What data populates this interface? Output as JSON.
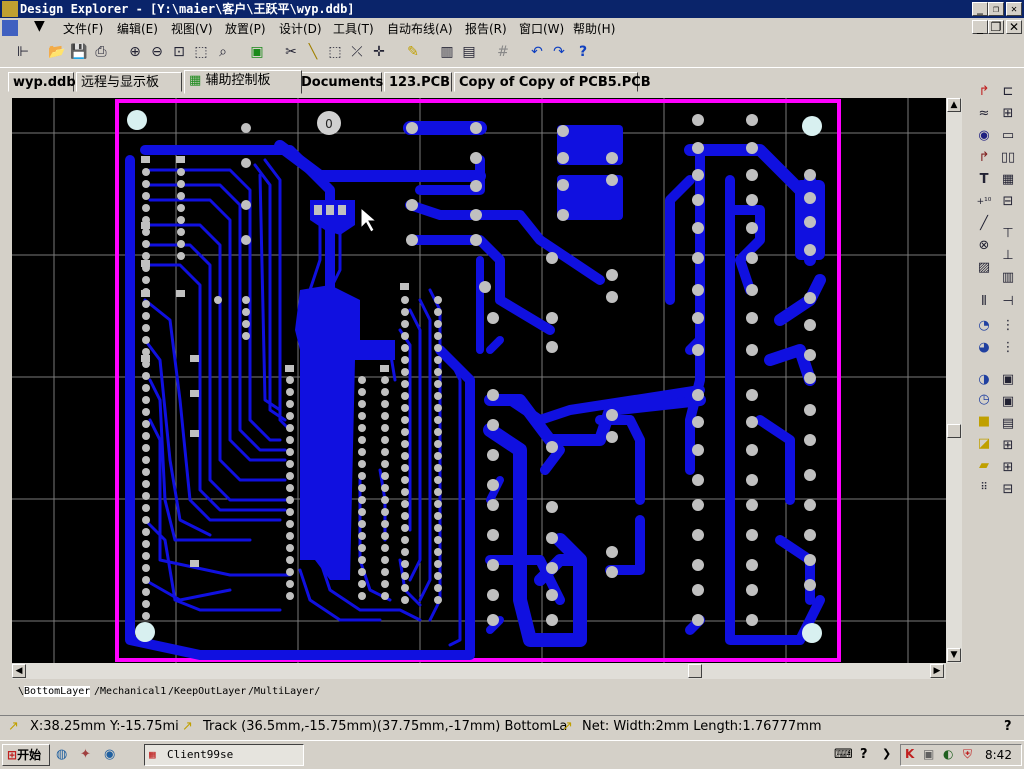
{
  "window": {
    "title": "Design Explorer - [Y:\\maier\\客户\\王跃平\\wyp.ddb]",
    "min_glyph": "_",
    "max_glyph": "❐",
    "close_glyph": "✕"
  },
  "menu": [
    "文件(F)",
    "编辑(E)",
    "视图(V)",
    "放置(P)",
    "设计(D)",
    "工具(T)",
    "自动布线(A)",
    "报告(R)",
    "窗口(W)",
    "帮助(H)"
  ],
  "doc_tabs": [
    {
      "label": "wyp.ddb",
      "bold": true
    },
    {
      "label": "远程与显示板",
      "bold": false
    },
    {
      "label": "辅助控制板",
      "bold": false,
      "active": true
    },
    {
      "label": "Documents",
      "bold": true
    },
    {
      "label": "123.PCB",
      "bold": true
    },
    {
      "label": "Copy of Copy of PCB5.PCB",
      "bold": true
    }
  ],
  "layer_tabs": [
    "BottomLayer",
    "Mechanical1",
    "KeepOutLayer",
    "MultiLayer"
  ],
  "status": {
    "coords": "X:38.25mm Y:-15.75mi",
    "track": "Track (36.5mm,-15.75mm)(37.75mm,-17mm)  BottomLa",
    "net": "Net: Width:2mm Length:1.76777mm"
  },
  "board": {
    "hole_label": "0"
  },
  "taskbar": {
    "start": "开始",
    "app": "Client99se",
    "clock": "8:42"
  },
  "colors": {
    "copper": "#1010e0",
    "outline": "#ff00ff",
    "pad": "#c0c0c0",
    "grid": "#7a7a7a"
  },
  "toolbar_icons": [
    "hierarchy-icon",
    "open-icon",
    "save-icon",
    "print-icon",
    "zoom-in-icon",
    "zoom-out-icon",
    "zoom-fit-icon",
    "zoom-area-icon",
    "zoom-select-icon",
    "component-icon",
    "cut-icon",
    "route-icon",
    "select-icon",
    "deselect-icon",
    "move-icon",
    "pen-icon",
    "library-icon",
    "browse-icon",
    "grid-icon",
    "undo-icon",
    "redo-icon",
    "help-icon"
  ],
  "sidebar_icons": [
    "interactive-route-icon",
    "wire-icon",
    "via-icon",
    "pad-icon",
    "string-icon",
    "coordinate-icon",
    "dimension-icon",
    "arc-center-icon",
    "arc-edge-icon",
    "fill-icon",
    "polygon-icon",
    "component-place-icon",
    "align-icon"
  ]
}
